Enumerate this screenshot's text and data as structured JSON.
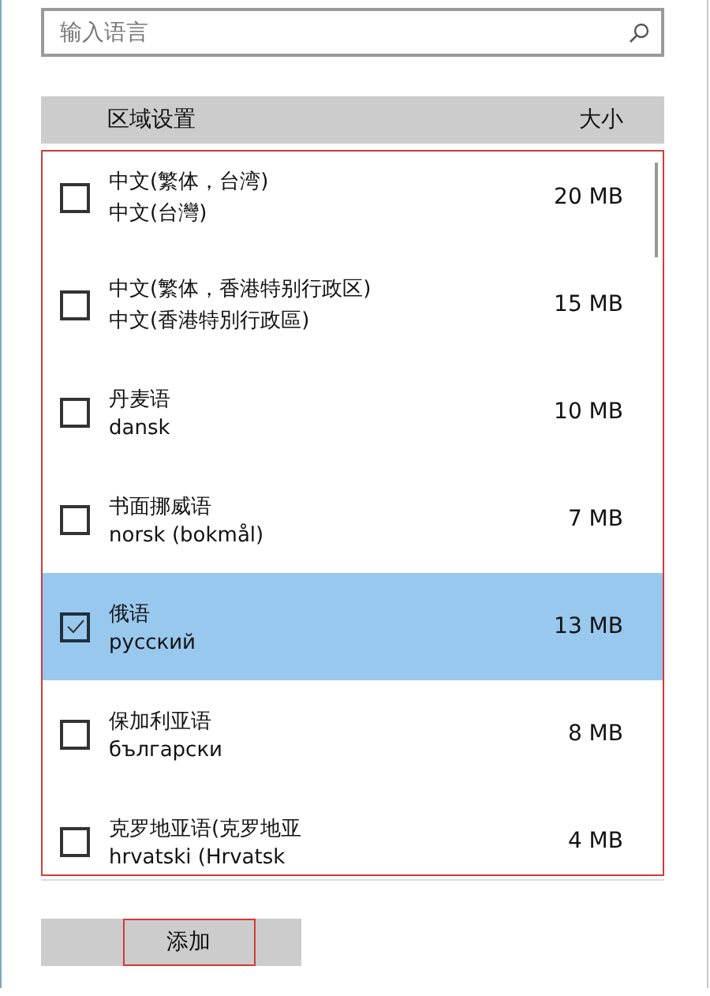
{
  "search": {
    "placeholder": "输入语言"
  },
  "columns": [
    "区域设置",
    "大小"
  ],
  "languages": [
    {
      "name": "中文(繁体，台湾)",
      "native": "中文(台灣)",
      "size": "20 MB",
      "checked": false,
      "selected": false
    },
    {
      "name": "中文(繁体，香港特别行政区)",
      "native": "中文(香港特別行政區)",
      "size": "15 MB",
      "checked": false,
      "selected": false
    },
    {
      "name": "丹麦语",
      "native": "dansk",
      "size": "10 MB",
      "checked": false,
      "selected": false
    },
    {
      "name": "书面挪威语",
      "native": "norsk (bokmål)",
      "size": "7 MB",
      "checked": false,
      "selected": false
    },
    {
      "name": "俄语",
      "native": "русский",
      "size": "13 MB",
      "checked": true,
      "selected": true
    },
    {
      "name": "保加利亚语",
      "native": "български",
      "size": "8 MB",
      "checked": false,
      "selected": false
    },
    {
      "name": "克罗地亚语(克罗地亚",
      "native": "hrvatski (Hrvatsk",
      "size": "4 MB",
      "checked": false,
      "selected": false
    }
  ],
  "list_highlighted": true,
  "add_button": {
    "label": "添加",
    "highlighted": true
  }
}
